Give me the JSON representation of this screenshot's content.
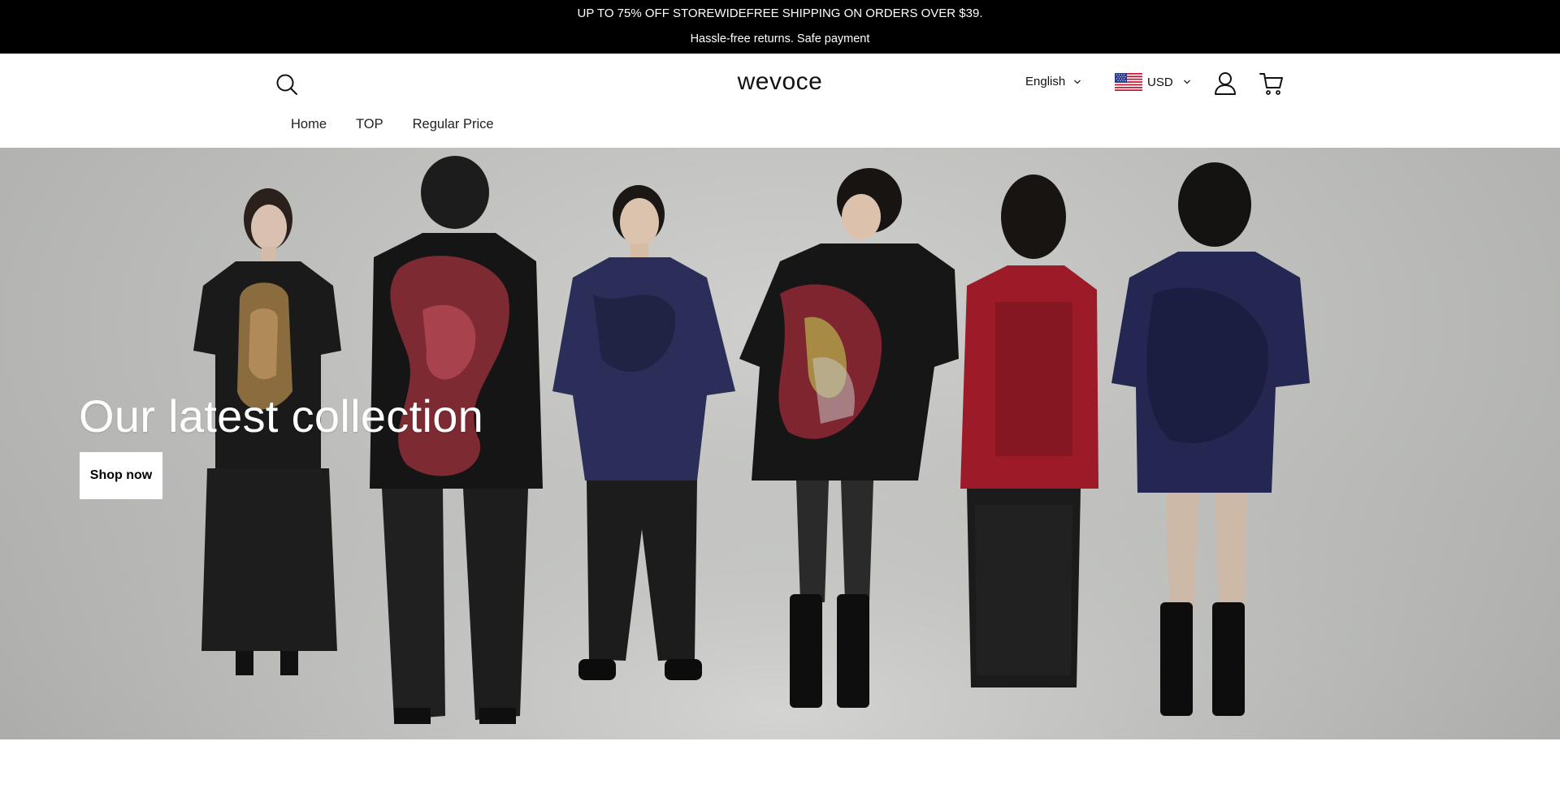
{
  "announcement": {
    "line1": "UP TO 75% OFF STOREWIDE⁣FREE SHIPPING ON ORDERS OVER $39.",
    "line2": "Hassle-free returns. Safe payment"
  },
  "header": {
    "logo": "wevoce",
    "language": "English",
    "currency": "USD",
    "icons": {
      "search": "search-icon",
      "account": "user-icon",
      "cart": "cart-icon",
      "flag": "us-flag-icon",
      "dropdown": "chevron-down-icon"
    }
  },
  "nav": {
    "items": [
      {
        "label": "Home"
      },
      {
        "label": "TOP"
      },
      {
        "label": "Regular Price"
      }
    ]
  },
  "hero": {
    "title": "Our latest collection",
    "button_label": "Shop now"
  },
  "colors": {
    "announcement_bg": "#000000",
    "hero_bg": "#c5c6c3",
    "button_bg": "#ffffff"
  }
}
